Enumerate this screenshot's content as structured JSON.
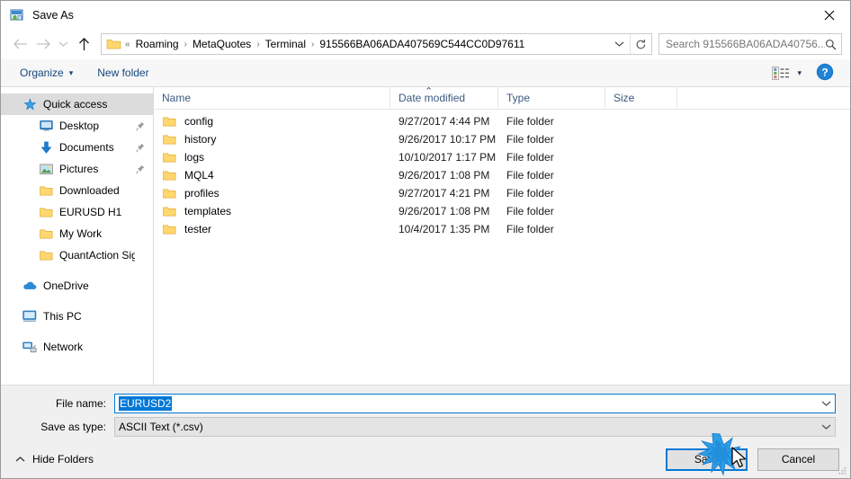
{
  "window": {
    "title": "Save As",
    "icon": "save-as-icon",
    "close_label": "✕"
  },
  "nav": {
    "back_icon": "arrow-left-icon",
    "forward_icon": "arrow-right-icon",
    "recent_icon": "chevron-down-icon",
    "up_icon": "arrow-up-icon",
    "breadcrumb_prefix": "«",
    "breadcrumb": [
      "Roaming",
      "MetaQuotes",
      "Terminal",
      "915566BA06ADA407569C544CC0D97611"
    ],
    "breadcrumb_separator": "›",
    "dropdown_icon": "chevron-down-icon",
    "refresh_icon": "refresh-icon"
  },
  "search": {
    "placeholder": "Search 915566BA06ADA40756...",
    "icon": "search-icon"
  },
  "toolbar": {
    "organize_label": "Organize",
    "organize_caret": "▾",
    "new_folder_label": "New folder",
    "view_icon": "view-mode-icon",
    "view_caret": "▾",
    "help_icon": "help-icon",
    "help_label": "?"
  },
  "sidebar": {
    "items": [
      {
        "label": "Quick access",
        "icon": "star-icon",
        "indent": "lvl0",
        "selected": true,
        "pinned": false
      },
      {
        "label": "Desktop",
        "icon": "monitor-icon",
        "indent": "lvl1",
        "selected": false,
        "pinned": true
      },
      {
        "label": "Documents",
        "icon": "download-icon",
        "indent": "lvl1",
        "selected": false,
        "pinned": true
      },
      {
        "label": "Pictures",
        "icon": "picture-icon",
        "indent": "lvl1",
        "selected": false,
        "pinned": true
      },
      {
        "label": "Downloaded",
        "icon": "folder-icon",
        "indent": "lvl1",
        "selected": false,
        "pinned": false
      },
      {
        "label": "EURUSD H1",
        "icon": "folder-icon",
        "indent": "lvl1",
        "selected": false,
        "pinned": false
      },
      {
        "label": "My Work",
        "icon": "folder-icon",
        "indent": "lvl1",
        "selected": false,
        "pinned": false
      },
      {
        "label": "QuantAction Signal",
        "icon": "folder-icon",
        "indent": "lvl1",
        "selected": false,
        "pinned": false
      },
      {
        "label": "OneDrive",
        "icon": "onedrive-icon",
        "indent": "lvl0",
        "selected": false,
        "pinned": false,
        "gap_before": true
      },
      {
        "label": "This PC",
        "icon": "thispc-icon",
        "indent": "lvl0",
        "selected": false,
        "pinned": false,
        "gap_before": true
      },
      {
        "label": "Network",
        "icon": "network-icon",
        "indent": "lvl0",
        "selected": false,
        "pinned": false,
        "gap_before": true
      }
    ]
  },
  "filelist": {
    "columns": [
      "Name",
      "Date modified",
      "Type",
      "Size"
    ],
    "sort_indicator": "⌃",
    "rows": [
      {
        "name": "config",
        "date": "9/27/2017 4:44 PM",
        "type": "File folder",
        "size": "",
        "icon": "folder-icon"
      },
      {
        "name": "history",
        "date": "9/26/2017 10:17 PM",
        "type": "File folder",
        "size": "",
        "icon": "folder-icon"
      },
      {
        "name": "logs",
        "date": "10/10/2017 1:17 PM",
        "type": "File folder",
        "size": "",
        "icon": "folder-icon"
      },
      {
        "name": "MQL4",
        "date": "9/26/2017 1:08 PM",
        "type": "File folder",
        "size": "",
        "icon": "folder-icon"
      },
      {
        "name": "profiles",
        "date": "9/27/2017 4:21 PM",
        "type": "File folder",
        "size": "",
        "icon": "folder-icon"
      },
      {
        "name": "templates",
        "date": "9/26/2017 1:08 PM",
        "type": "File folder",
        "size": "",
        "icon": "folder-icon"
      },
      {
        "name": "tester",
        "date": "10/4/2017 1:35 PM",
        "type": "File folder",
        "size": "",
        "icon": "folder-icon"
      }
    ]
  },
  "form": {
    "filename_label": "File name:",
    "filename_value": "EURUSD2",
    "filetype_label": "Save as type:",
    "filetype_value": "ASCII Text (*.csv)",
    "chevron_icon": "chevron-down-icon"
  },
  "footer": {
    "hide_folders_label": "Hide Folders",
    "hide_folders_icon": "chevron-up-icon",
    "save_label": "Save",
    "cancel_label": "Cancel",
    "resize_grip_icon": "resize-grip-icon"
  },
  "colors": {
    "accent": "#0078d7",
    "toolbar_link": "#14477d",
    "selection": "#0078d7",
    "folder_yellow": "#ffd76e",
    "header_text": "#3b5a7f"
  },
  "cursor": {
    "click_effect": "starburst",
    "icon": "mouse-pointer-icon"
  }
}
